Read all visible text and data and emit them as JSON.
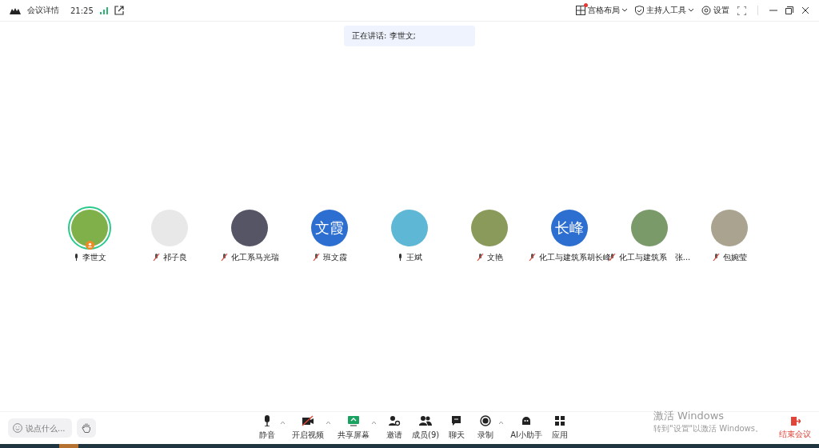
{
  "title_bar": {
    "meeting_info": "会议详情",
    "time": "21:25",
    "layout": {
      "label": "宫格布局",
      "notification": true
    },
    "host_tools": "主持人工具",
    "settings": "设置"
  },
  "speaking_banner": "正在讲话: 李世文;",
  "participants": [
    {
      "name": "李世文",
      "muted": false,
      "speaking": true,
      "host": true
    },
    {
      "name": "祁子良",
      "muted": true,
      "speaking": false,
      "host": false
    },
    {
      "name": "化工系马光瑞",
      "muted": true,
      "speaking": false,
      "host": false
    },
    {
      "name": "班文霞",
      "avatar_text": "文霞",
      "muted": true,
      "speaking": false,
      "host": false
    },
    {
      "name": "王斌",
      "muted": false,
      "speaking": false,
      "host": false
    },
    {
      "name": "文艳",
      "muted": true,
      "speaking": false,
      "host": false
    },
    {
      "name": "化工与建筑系胡长峰",
      "avatar_text": "长峰",
      "muted": true,
      "speaking": false,
      "host": false
    },
    {
      "name": "化工与建筑系　张...",
      "muted": true,
      "speaking": false,
      "host": false
    },
    {
      "name": "包婉莹",
      "muted": true,
      "speaking": false,
      "host": false
    }
  ],
  "chat_input": {
    "placeholder": "说点什么..."
  },
  "toolbar": [
    {
      "kind": "mic",
      "label": "静音",
      "caret": true
    },
    {
      "kind": "video",
      "label": "开启视频",
      "caret": true
    },
    {
      "kind": "share",
      "label": "共享屏幕",
      "caret": true
    },
    {
      "kind": "invite",
      "label": "邀请",
      "caret": false
    },
    {
      "kind": "members",
      "label": "成员(9)",
      "caret": false
    },
    {
      "kind": "chat",
      "label": "聊天",
      "caret": false
    },
    {
      "kind": "record",
      "label": "录制",
      "caret": true
    },
    {
      "kind": "ai",
      "label": "AI小助手",
      "caret": false
    },
    {
      "kind": "apps",
      "label": "应用",
      "caret": false
    }
  ],
  "end_meeting": "结束会议",
  "activation_notice": {
    "title": "激活 Windows",
    "message": "转到\"设置\"以激活 Windows。"
  }
}
